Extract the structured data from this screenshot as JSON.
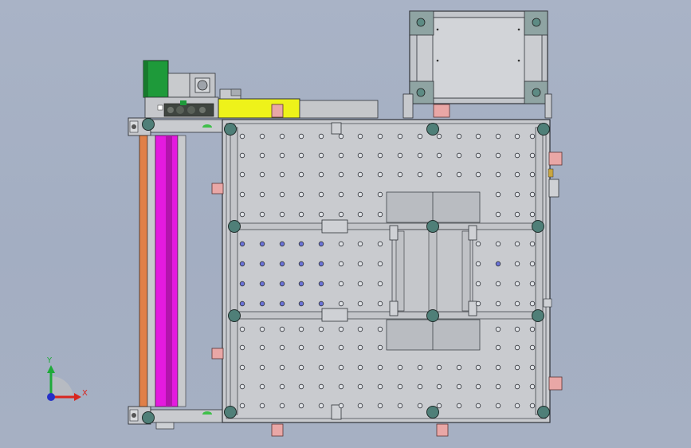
{
  "viewport": {
    "background_color": "#a6b0c3"
  },
  "triad": {
    "y_label": "Y",
    "x_label": "X",
    "y_color": "#1faa3a",
    "x_color": "#d8261f",
    "z_color": "#2530c8"
  },
  "colors": {
    "frame_plate": "#c9cbcf",
    "frame_line": "#3a3d44",
    "hole_fill": "#dfe2e6",
    "highlight_hole": "#6b73d8",
    "motor_green": "#1e9a3a",
    "linear_rail": "#e41adf",
    "orange_rail": "#e08048",
    "yellow_block": "#eef21a",
    "pink_tab": "#e9a7a6",
    "corner_post": "#4f7f78"
  }
}
